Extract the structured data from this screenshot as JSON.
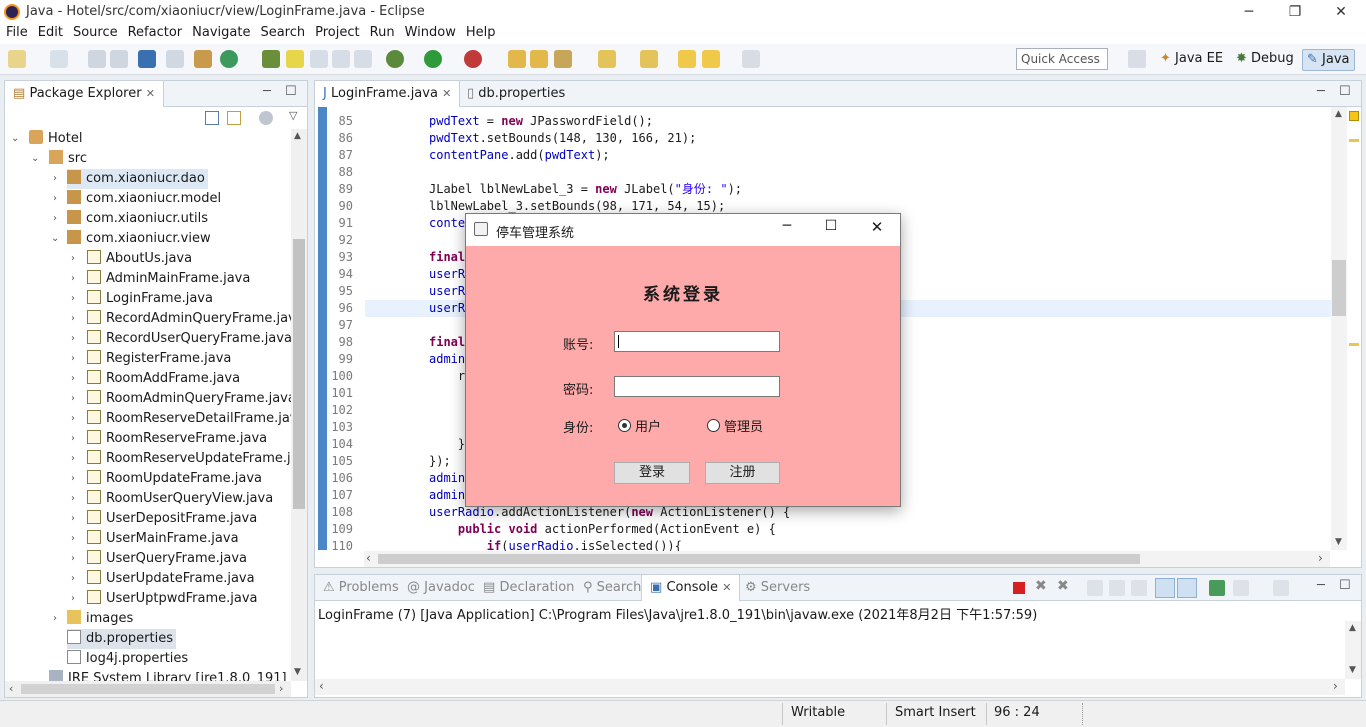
{
  "window": {
    "title": "Java - Hotel/src/com/xiaoniucr/view/LoginFrame.java - Eclipse"
  },
  "menu": [
    "File",
    "Edit",
    "Source",
    "Refactor",
    "Navigate",
    "Search",
    "Project",
    "Run",
    "Window",
    "Help"
  ],
  "quick_access": "Quick Access",
  "perspectives": [
    "Java EE",
    "Debug",
    "Java"
  ],
  "package_explorer": {
    "title": "Package Explorer",
    "items": {
      "project": "Hotel",
      "src": "src",
      "pkg_dao": "com.xiaoniucr.dao",
      "pkg_model": "com.xiaoniucr.model",
      "pkg_utils": "com.xiaoniucr.utils",
      "pkg_view": "com.xiaoniucr.view",
      "files": [
        "AboutUs.java",
        "AdminMainFrame.java",
        "LoginFrame.java",
        "RecordAdminQueryFrame.java",
        "RecordUserQueryFrame.java",
        "RegisterFrame.java",
        "RoomAddFrame.java",
        "RoomAdminQueryFrame.java",
        "RoomReserveDetailFrame.java",
        "RoomReserveFrame.java",
        "RoomReserveUpdateFrame.java",
        "RoomUpdateFrame.java",
        "RoomUserQueryView.java",
        "UserDepositFrame.java",
        "UserMainFrame.java",
        "UserQueryFrame.java",
        "UserUpdateFrame.java",
        "UserUptpwdFrame.java"
      ],
      "images": "images",
      "db": "db.properties",
      "log4j": "log4j.properties",
      "jre": "JRE System Library [jre1.8.0_191]"
    }
  },
  "editor": {
    "tabs": [
      "LoginFrame.java",
      "db.properties"
    ],
    "line_numbers": [
      "85",
      "86",
      "87",
      "88",
      "89",
      "90",
      "91",
      "92",
      "93",
      "94",
      "95",
      "96",
      "97",
      "98",
      "99",
      "100",
      "101",
      "102",
      "103",
      "104",
      "105",
      "106",
      "107",
      "108",
      "109",
      "110"
    ],
    "lines": [
      "pwdText = new JPasswordField();",
      "pwdText.setBounds(148, 130, 166, 21);",
      "contentPane.add(pwdText);",
      "",
      "JLabel lblNewLabel_3 = new JLabel(\"身份: \");",
      "lblNewLabel_3.setBounds(98, 171, 54, 15);",
      "conte",
      "",
      "final",
      "userR",
      "userR",
      "userR",
      "",
      "final",
      "admin",
      "    r",
      "",
      "",
      "",
      "    }",
      "});",
      "admin",
      "admin",
      "userRadio.addActionListener(new ActionListener() {",
      "    public void actionPerformed(ActionEvent e) {",
      "        if(userRadio.isSelected()){"
    ]
  },
  "dialog": {
    "title": "停车管理系统",
    "heading": "系统登录",
    "account_label": "账号:",
    "account_value": "",
    "password_label": "密码:",
    "password_value": "",
    "role_label": "身份:",
    "role_user": "用户",
    "role_admin": "管理员",
    "selected_role": "用户",
    "login_button": "登录",
    "register_button": "注册",
    "bg_color": "#ffaaaa"
  },
  "console": {
    "tabs": [
      "Problems",
      "Javadoc",
      "Declaration",
      "Search",
      "Console",
      "Servers"
    ],
    "active_tab": "Console",
    "output": "LoginFrame (7) [Java Application] C:\\Program Files\\Java\\jre1.8.0_191\\bin\\javaw.exe (2021年8月2日 下午1:57:59)"
  },
  "status": {
    "writable": "Writable",
    "insert": "Smart Insert",
    "position": "96 : 24"
  }
}
